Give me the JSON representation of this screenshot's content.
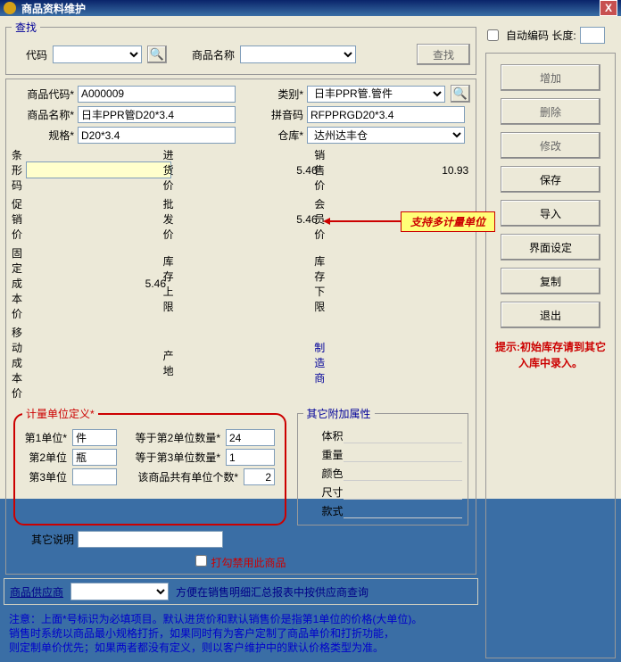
{
  "window": {
    "title": "商品资料维护",
    "close": "X"
  },
  "search": {
    "legend": "查找",
    "code_label": "代码",
    "name_label": "商品名称",
    "btn": "查找"
  },
  "autocode": {
    "label": "自动编码 长度:"
  },
  "form": {
    "code_lbl": "商品代码*",
    "code_val": "A000009",
    "cat_lbl": "类别*",
    "cat_val": "日丰PPR管.管件",
    "name_lbl": "商品名称*",
    "name_val": "日丰PPR管D20*3.4",
    "pinyin_lbl": "拼音码",
    "pinyin_val": "RFPPRGD20*3.4",
    "spec_lbl": "规格*",
    "spec_val": "D20*3.4",
    "store_lbl": "仓库*",
    "store_val": "达州达丰仓",
    "barcode_lbl": "条形码",
    "inprice_lbl": "进货价",
    "inprice_val": "5.46",
    "saleprice_lbl": "销售价",
    "saleprice_val": "10.93",
    "promo_lbl": "促销价",
    "wholesale_lbl": "批发价",
    "wholesale_val": "5.46",
    "member_lbl": "会员价",
    "fixcost_lbl": "固定成本价",
    "fixcost_val": "5.46",
    "stockup_lbl": "库存上限",
    "stockdown_lbl": "库存下限",
    "movecost_lbl": "移动成本价",
    "origin_lbl": "产地",
    "maker_lbl": "制造商"
  },
  "callout": "支持多计量单位",
  "unit_def": {
    "legend": "计量单位定义*",
    "u1_lbl": "第1单位*",
    "u1_val": "件",
    "u1q_lbl": "等于第2单位数量*",
    "u1q_val": "24",
    "u2_lbl": "第2单位",
    "u2_val": "瓶",
    "u2q_lbl": "等于第3单位数量*",
    "u2q_val": "1",
    "u3_lbl": "第3单位",
    "u3q_lbl": "该商品共有单位个数*",
    "u3q_val": "2"
  },
  "extra": {
    "legend": "其它附加属性",
    "volume": "体积",
    "weight": "重量",
    "color": "颜色",
    "size": "尺寸",
    "style": "款式"
  },
  "other_desc_lbl": "其它说明",
  "disable_lbl": "打勾禁用此商品",
  "supplier": {
    "label": "商品供应商",
    "tip": "方便在销售明细汇总报表中按供应商查询"
  },
  "notice": "注意：上面*号标识为必填项目。默认进货价和默认销售价是指第1单位的价格(大单位)。\n销售时系统以商品最小规格打折，如果同时有为客户定制了商品单价和打折功能，\n则定制单价优先；如果两者都没有定义，则以客户维护中的默认价格类型为准。",
  "buttons": {
    "add": "增加",
    "delete": "删除",
    "modify": "修改",
    "save": "保存",
    "import": "导入",
    "uiset": "界面设定",
    "copy": "复制",
    "exit": "退出"
  },
  "hint": "提示:初始库存请到其它\n入库中录入。"
}
